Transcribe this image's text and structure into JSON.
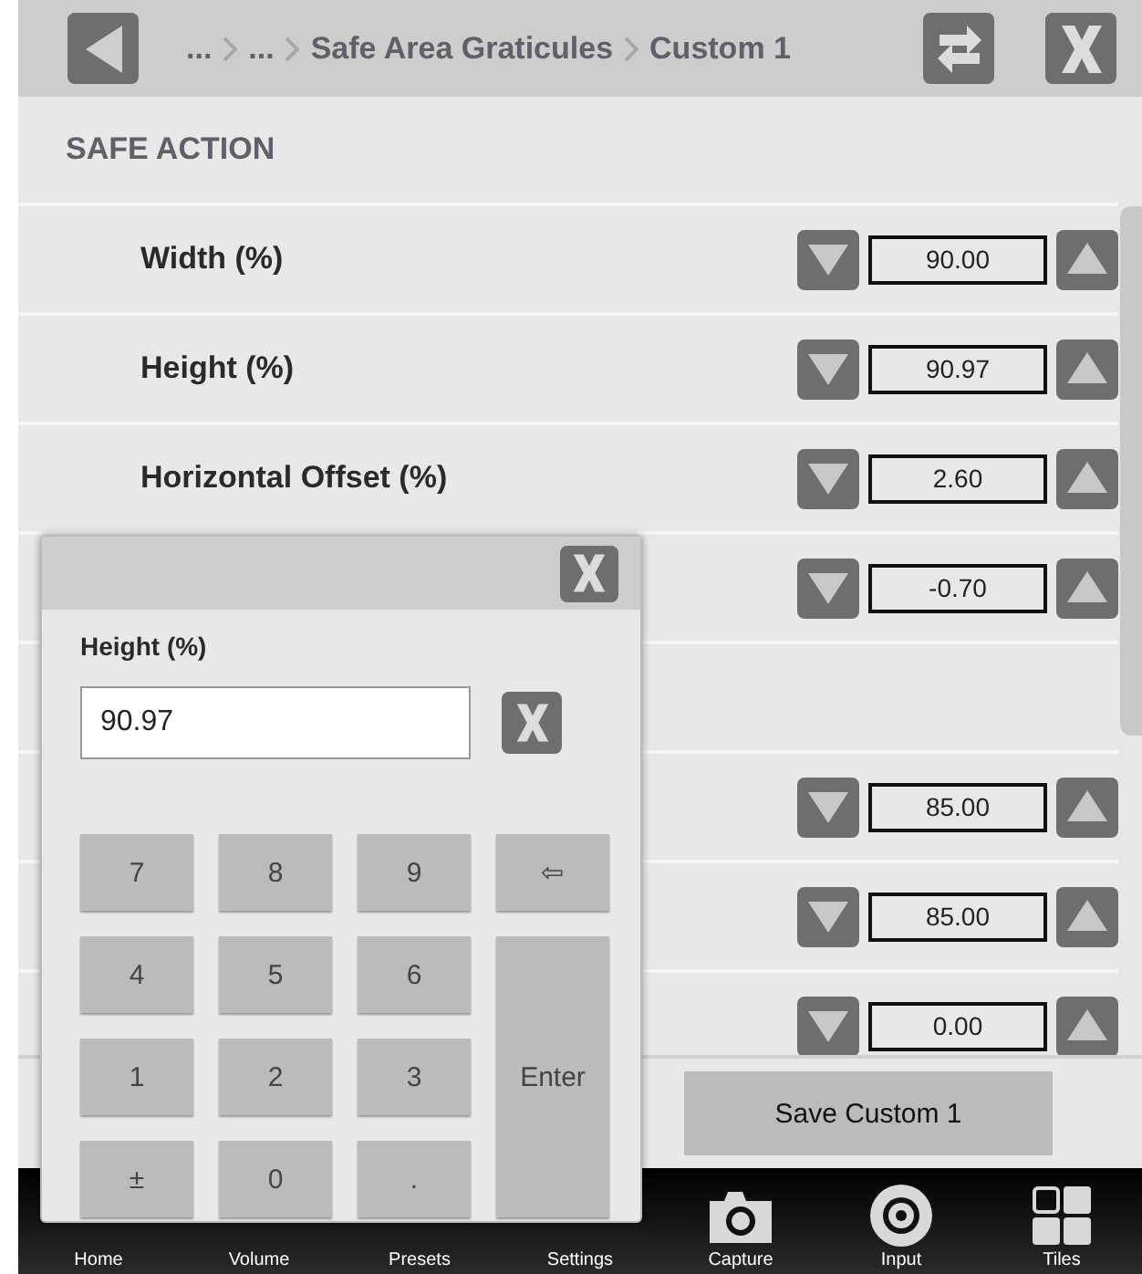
{
  "topbar": {
    "breadcrumb": [
      "...",
      "...",
      "Safe Area Graticules",
      "Custom 1"
    ]
  },
  "sections": [
    {
      "title": "SAFE ACTION",
      "rows": [
        {
          "label": "Width (%)",
          "value": "90.00"
        },
        {
          "label": "Height (%)",
          "value": "90.97"
        },
        {
          "label": "Horizontal Offset (%)",
          "value": "2.60"
        },
        {
          "value": "-0.70"
        }
      ]
    },
    {
      "rows": [
        {
          "value": "85.00"
        },
        {
          "value": "85.00"
        },
        {
          "value": "0.00"
        }
      ]
    }
  ],
  "save_button": "Save Custom 1",
  "nav": [
    {
      "label": "Home"
    },
    {
      "label": "Volume"
    },
    {
      "label": "Presets"
    },
    {
      "label": "Settings"
    },
    {
      "label": "Capture",
      "kind": "capture"
    },
    {
      "label": "Input",
      "kind": "input"
    },
    {
      "label": "Tiles",
      "kind": "tiles"
    }
  ],
  "keypad_dialog": {
    "label": "Height (%)",
    "value": "90.97",
    "keys": [
      {
        "text": "7"
      },
      {
        "text": "8"
      },
      {
        "text": "9"
      },
      {
        "text": "⇦"
      },
      {
        "text": "4"
      },
      {
        "text": "5"
      },
      {
        "text": "6"
      },
      {
        "text": "1"
      },
      {
        "text": "2"
      },
      {
        "text": "3"
      },
      {
        "text": "Enter",
        "kind": "tall"
      },
      {
        "text": "±"
      },
      {
        "text": "0"
      },
      {
        "text": "."
      }
    ]
  }
}
